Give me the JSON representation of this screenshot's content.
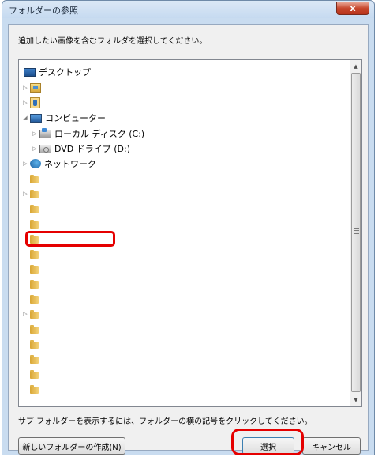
{
  "window": {
    "title": "フォルダーの参照",
    "close_label": "x",
    "instruction": "追加したい画像を含むフォルダを選択してください。",
    "hint": "サブ フォルダーを表示するには、フォルダーの横の記号をクリックしてください。"
  },
  "tree": {
    "desktop": "デスクトップ",
    "computer": "コンピューター",
    "local_disk": "ローカル ディスク (C:)",
    "dvd_drive": "DVD ドライブ (D:)",
    "network": "ネットワーク",
    "expander_collapsed": "▷",
    "expander_expanded": "◢"
  },
  "buttons": {
    "new_folder": "新しいフォルダーの作成(N)",
    "select": "選択",
    "cancel": "キャンセル"
  },
  "scrollbar": {
    "up": "▲",
    "down": "▼"
  },
  "colors": {
    "highlight": "#e50000",
    "title_bar": "#c6daf0",
    "close_button": "#c7472c"
  }
}
